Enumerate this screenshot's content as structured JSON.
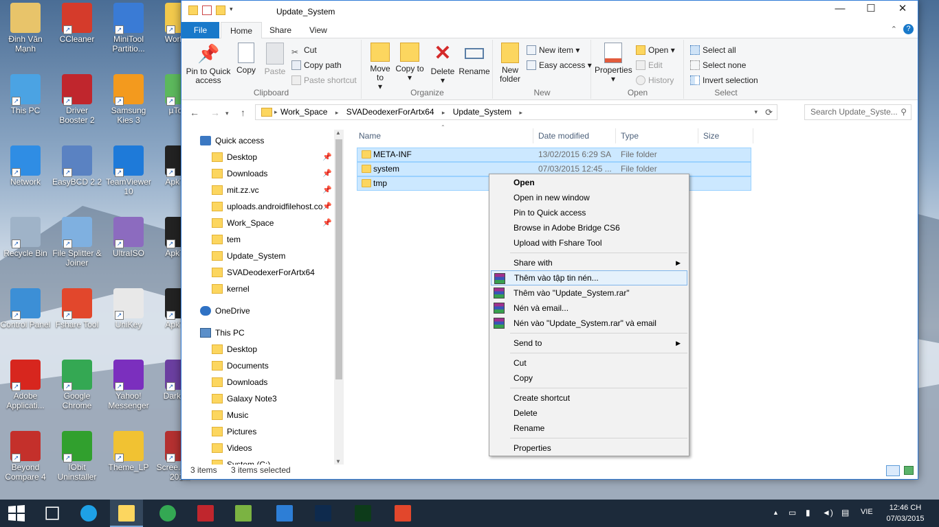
{
  "desktop": {
    "icons": [
      {
        "label": "Đinh Văn Mạnh",
        "icon": "user-folder-icon",
        "color": "#e8c46a"
      },
      {
        "label": "CCleaner",
        "icon": "ccleaner-icon",
        "color": "#d53b2b"
      },
      {
        "label": "MiniTool Partitio...",
        "icon": "minitool-icon",
        "color": "#3a7bd5"
      },
      {
        "label": "Work_...",
        "icon": "folder-icon",
        "color": "#f2c94c"
      },
      {
        "label": "This PC",
        "icon": "computer-icon",
        "color": "#4ba3e3"
      },
      {
        "label": "Driver Booster 2",
        "icon": "driver-booster-icon",
        "color": "#c0262d"
      },
      {
        "label": "Samsung Kies 3",
        "icon": "samsung-kies-icon",
        "color": "#f39a1e"
      },
      {
        "label": "µTor...",
        "icon": "utorrent-icon",
        "color": "#5cb85c"
      },
      {
        "label": "Network",
        "icon": "network-icon",
        "color": "#2f8de4"
      },
      {
        "label": "EasyBCD 2.2",
        "icon": "easybcd-icon",
        "color": "#5a82c2"
      },
      {
        "label": "TeamViewer 10",
        "icon": "teamviewer-icon",
        "color": "#1e7ad9"
      },
      {
        "label": "ApkTo...",
        "icon": "terminal-icon",
        "color": "#222222"
      },
      {
        "label": "Recycle Bin",
        "icon": "recycle-bin-icon",
        "color": "#9fb3c8"
      },
      {
        "label": "File Splitter & Joiner",
        "icon": "file-splitter-icon",
        "color": "#7fb0e0"
      },
      {
        "label": "UltraISO",
        "icon": "ultraiso-icon",
        "color": "#8c6bbf"
      },
      {
        "label": "ApkTo...",
        "icon": "terminal-icon",
        "color": "#222222"
      },
      {
        "label": "Control Panel",
        "icon": "control-panel-icon",
        "color": "#3c8fd6"
      },
      {
        "label": "Fshare Tool",
        "icon": "fshare-icon",
        "color": "#e2472c"
      },
      {
        "label": "UniKey",
        "icon": "unikey-icon",
        "color": "#e8e8e8"
      },
      {
        "label": "ApkTo...",
        "icon": "terminal-icon",
        "color": "#222222"
      },
      {
        "label": "Adobe Applicati...",
        "icon": "adobe-icon",
        "color": "#d7261e"
      },
      {
        "label": "Google Chrome",
        "icon": "chrome-icon",
        "color": "#34a853"
      },
      {
        "label": "Yahoo! Messenger",
        "icon": "yahoo-icon",
        "color": "#7b2fbe"
      },
      {
        "label": "DarkLo...",
        "icon": "rar-icon",
        "color": "#6b3fa0"
      },
      {
        "label": "Beyond Compare 4",
        "icon": "beyond-compare-icon",
        "color": "#c4302b"
      },
      {
        "label": "IObit Uninstaller",
        "icon": "iobit-icon",
        "color": "#31a02e"
      },
      {
        "label": "Theme_LP",
        "icon": "theme-icon",
        "color": "#f1c232"
      },
      {
        "label": "Scree... from 201...",
        "icon": "image-icon",
        "color": "#b43030"
      }
    ]
  },
  "window": {
    "title": "Update_System",
    "controls": {
      "minimize": "—",
      "maximize": "☐",
      "close": "✕"
    },
    "tabs": [
      "File",
      "Home",
      "Share",
      "View"
    ],
    "ribbon": {
      "clipboard": {
        "label": "Clipboard",
        "pin": "Pin to Quick access",
        "copy": "Copy",
        "paste": "Paste",
        "cut": "Cut",
        "copy_path": "Copy path",
        "paste_shortcut": "Paste shortcut"
      },
      "organize": {
        "label": "Organize",
        "move_to": "Move to",
        "copy_to": "Copy to",
        "delete": "Delete",
        "rename": "Rename"
      },
      "new": {
        "label": "New",
        "new_folder": "New folder",
        "new_item": "New item",
        "easy_access": "Easy access"
      },
      "open": {
        "label": "Open",
        "properties": "Properties",
        "open": "Open",
        "edit": "Edit",
        "history": "History"
      },
      "select": {
        "label": "Select",
        "select_all": "Select all",
        "select_none": "Select none",
        "invert": "Invert selection"
      }
    },
    "address": {
      "crumbs": [
        "Work_Space",
        "SVADeodexerForArtx64",
        "Update_System"
      ],
      "search_placeholder": "Search Update_Syste..."
    },
    "nav": {
      "quick_access": "Quick access",
      "quick_items": [
        "Desktop",
        "Downloads",
        "mit.zz.vc",
        "uploads.androidfilehost.co",
        "Work_Space",
        "tem",
        "Update_System",
        "SVADeodexerForArtx64",
        "kernel"
      ],
      "onedrive": "OneDrive",
      "this_pc": "This PC",
      "pc_items": [
        "Desktop",
        "Documents",
        "Downloads",
        "Galaxy Note3",
        "Music",
        "Pictures",
        "Videos",
        "System (C:)"
      ]
    },
    "columns": {
      "name": "Name",
      "date": "Date modified",
      "type": "Type",
      "size": "Size"
    },
    "files": [
      {
        "name": "META-INF",
        "date": "13/02/2015 6:29 SA",
        "type": "File folder"
      },
      {
        "name": "system",
        "date": "07/03/2015 12:45 ...",
        "type": "File folder"
      },
      {
        "name": "tmp",
        "date": "",
        "type": ""
      }
    ],
    "status": {
      "count": "3 items",
      "selected": "3 items selected"
    }
  },
  "context_menu": {
    "group1": [
      "Open",
      "Open in new window",
      "Pin to Quick access",
      "Browse in Adobe Bridge CS6",
      "Upload with Fshare Tool"
    ],
    "share_with": "Share with",
    "rar": [
      "Thêm vào tập tin nén...",
      "Thêm vào \"Update_System.rar\"",
      "Nén và email...",
      "Nén vào \"Update_System.rar\" và email"
    ],
    "send_to": "Send to",
    "clip": [
      "Cut",
      "Copy"
    ],
    "edit": [
      "Create shortcut",
      "Delete",
      "Rename"
    ],
    "properties": "Properties"
  },
  "taskbar": {
    "apps": [
      "Start",
      "Task View",
      "Internet Explorer",
      "File Explorer",
      "Chrome Remote",
      "Driver Booster",
      "Notepad++",
      "Downloader",
      "Photoshop",
      "Dreamweaver",
      "Fshare"
    ],
    "language": "VIE",
    "time": "12:46 CH",
    "date": "07/03/2015"
  },
  "colors": {
    "accent": "#1979ca",
    "selection": "#cce8ff",
    "taskbar": "#1c2a3a"
  }
}
